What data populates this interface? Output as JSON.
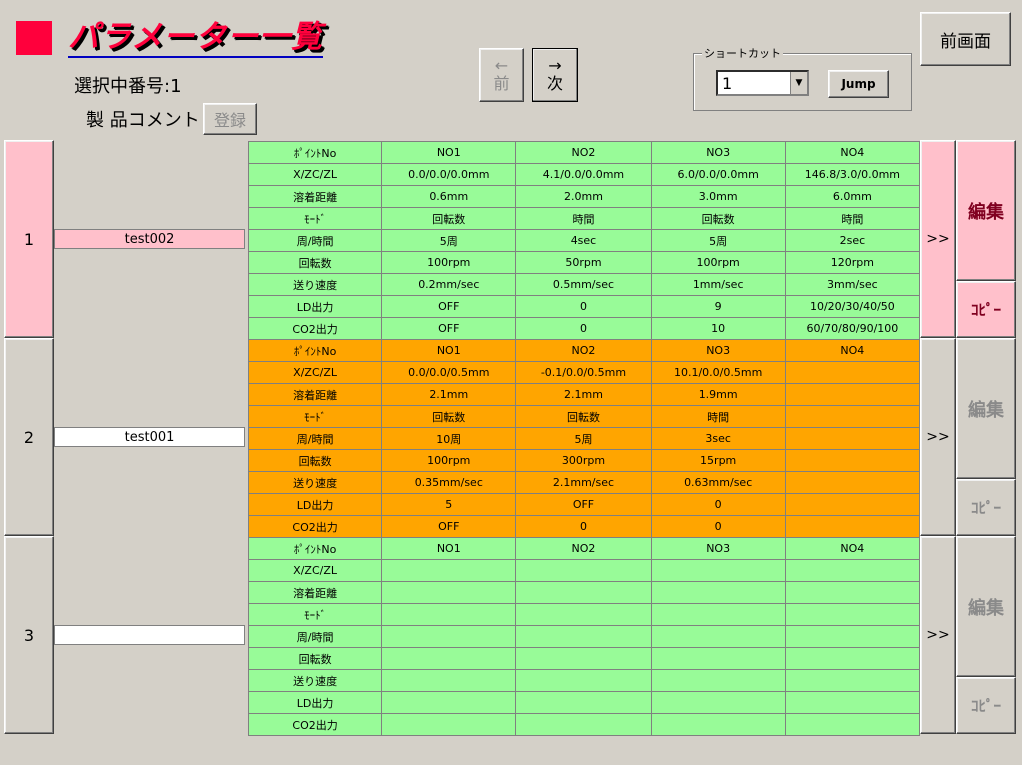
{
  "header": {
    "title": "パラメーター一覧",
    "selected_label": "選択中番号:1",
    "comment_label": "製 品コメント",
    "register_label": "登録",
    "prev_arrow": "←",
    "prev_label": "前",
    "next_arrow": "→",
    "next_label": "次",
    "prev_screen_label": "前画面"
  },
  "shortcut": {
    "legend": "ショートカット",
    "value": "1",
    "jump_label": "Jump"
  },
  "colors": {
    "green": "#98fb98",
    "orange": "#ffa500",
    "pink": "#ffc0cb",
    "title_red": "#ff003c"
  },
  "blocks": [
    {
      "number": "1",
      "comment": "test002",
      "color": "green",
      "active": true,
      "arrow_label": ">>",
      "edit_label": "編集",
      "copy_label": "ｺﾋﾟｰ",
      "header": [
        "ﾎﾟｲﾝﾄNo",
        "NO1",
        "NO2",
        "NO3",
        "NO4"
      ],
      "rows": [
        [
          "X/ZC/ZL",
          "0.0/0.0/0.0mm",
          "4.1/0.0/0.0mm",
          "6.0/0.0/0.0mm",
          "146.8/3.0/0.0mm"
        ],
        [
          "溶着距離",
          "0.6mm",
          "2.0mm",
          "3.0mm",
          "6.0mm"
        ],
        [
          "ﾓｰﾄﾞ",
          "回転数",
          "時間",
          "回転数",
          "時間"
        ],
        [
          "周/時間",
          "5周",
          "4sec",
          "5周",
          "2sec"
        ],
        [
          "回転数",
          "100rpm",
          "50rpm",
          "100rpm",
          "120rpm"
        ],
        [
          "送り速度",
          "0.2mm/sec",
          "0.5mm/sec",
          "1mm/sec",
          "3mm/sec"
        ],
        [
          "LD出力",
          "OFF",
          "0",
          "9",
          "10/20/30/40/50"
        ],
        [
          "CO2出力",
          "OFF",
          "0",
          "10",
          "60/70/80/90/100"
        ]
      ]
    },
    {
      "number": "2",
      "comment": "test001",
      "color": "orange",
      "active": false,
      "arrow_label": ">>",
      "edit_label": "編集",
      "copy_label": "ｺﾋﾟｰ",
      "header": [
        "ﾎﾟｲﾝﾄNo",
        "NO1",
        "NO2",
        "NO3",
        "NO4"
      ],
      "rows": [
        [
          "X/ZC/ZL",
          "0.0/0.0/0.5mm",
          "-0.1/0.0/0.5mm",
          "10.1/0.0/0.5mm",
          ""
        ],
        [
          "溶着距離",
          "2.1mm",
          "2.1mm",
          "1.9mm",
          ""
        ],
        [
          "ﾓｰﾄﾞ",
          "回転数",
          "回転数",
          "時間",
          ""
        ],
        [
          "周/時間",
          "10周",
          "5周",
          "3sec",
          ""
        ],
        [
          "回転数",
          "100rpm",
          "300rpm",
          "15rpm",
          ""
        ],
        [
          "送り速度",
          "0.35mm/sec",
          "2.1mm/sec",
          "0.63mm/sec",
          ""
        ],
        [
          "LD出力",
          "5",
          "OFF",
          "0",
          ""
        ],
        [
          "CO2出力",
          "OFF",
          "0",
          "0",
          ""
        ]
      ]
    },
    {
      "number": "3",
      "comment": "",
      "color": "green",
      "active": false,
      "arrow_label": ">>",
      "edit_label": "編集",
      "copy_label": "ｺﾋﾟｰ",
      "header": [
        "ﾎﾟｲﾝﾄNo",
        "NO1",
        "NO2",
        "NO3",
        "NO4"
      ],
      "rows": [
        [
          "X/ZC/ZL",
          "",
          "",
          "",
          ""
        ],
        [
          "溶着距離",
          "",
          "",
          "",
          ""
        ],
        [
          "ﾓｰﾄﾞ",
          "",
          "",
          "",
          ""
        ],
        [
          "周/時間",
          "",
          "",
          "",
          ""
        ],
        [
          "回転数",
          "",
          "",
          "",
          ""
        ],
        [
          "送り速度",
          "",
          "",
          "",
          ""
        ],
        [
          "LD出力",
          "",
          "",
          "",
          ""
        ],
        [
          "CO2出力",
          "",
          "",
          "",
          ""
        ]
      ]
    }
  ]
}
